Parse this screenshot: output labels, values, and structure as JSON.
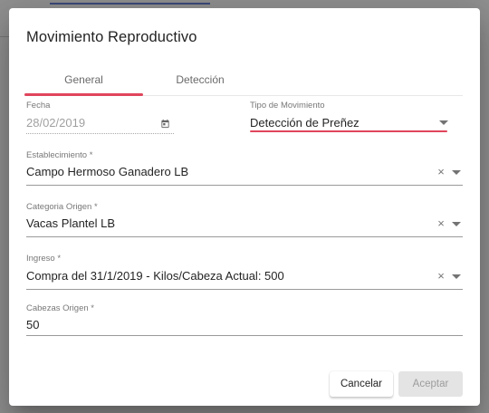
{
  "dialog": {
    "title": "Movimiento Reproductivo",
    "tabs": [
      {
        "label": "General",
        "active": true
      },
      {
        "label": "Detección",
        "active": false
      }
    ],
    "fields": {
      "fecha": {
        "label": "Fecha",
        "value": "28/02/2019",
        "icon": "calendar-icon"
      },
      "tipo_movimiento": {
        "label": "Tipo de Movimiento",
        "value": "Detección de Preñez"
      },
      "establecimiento": {
        "label": "Establecimiento *",
        "value": "Campo Hermoso Ganadero LB"
      },
      "categoria_origen": {
        "label": "Categoria Origen *",
        "value": "Vacas Plantel LB"
      },
      "ingreso": {
        "label": "Ingreso *",
        "value": "Compra del 31/1/2019 - Kilos/Cabeza Actual: 500"
      },
      "cabezas_origen": {
        "label": "Cabezas Origen *",
        "value": "50"
      }
    },
    "clear_glyph": "×",
    "buttons": {
      "cancel": "Cancelar",
      "accept": "Aceptar"
    }
  },
  "colors": {
    "accent": "#e0455d",
    "disabled_button": "#e4e4e4"
  }
}
